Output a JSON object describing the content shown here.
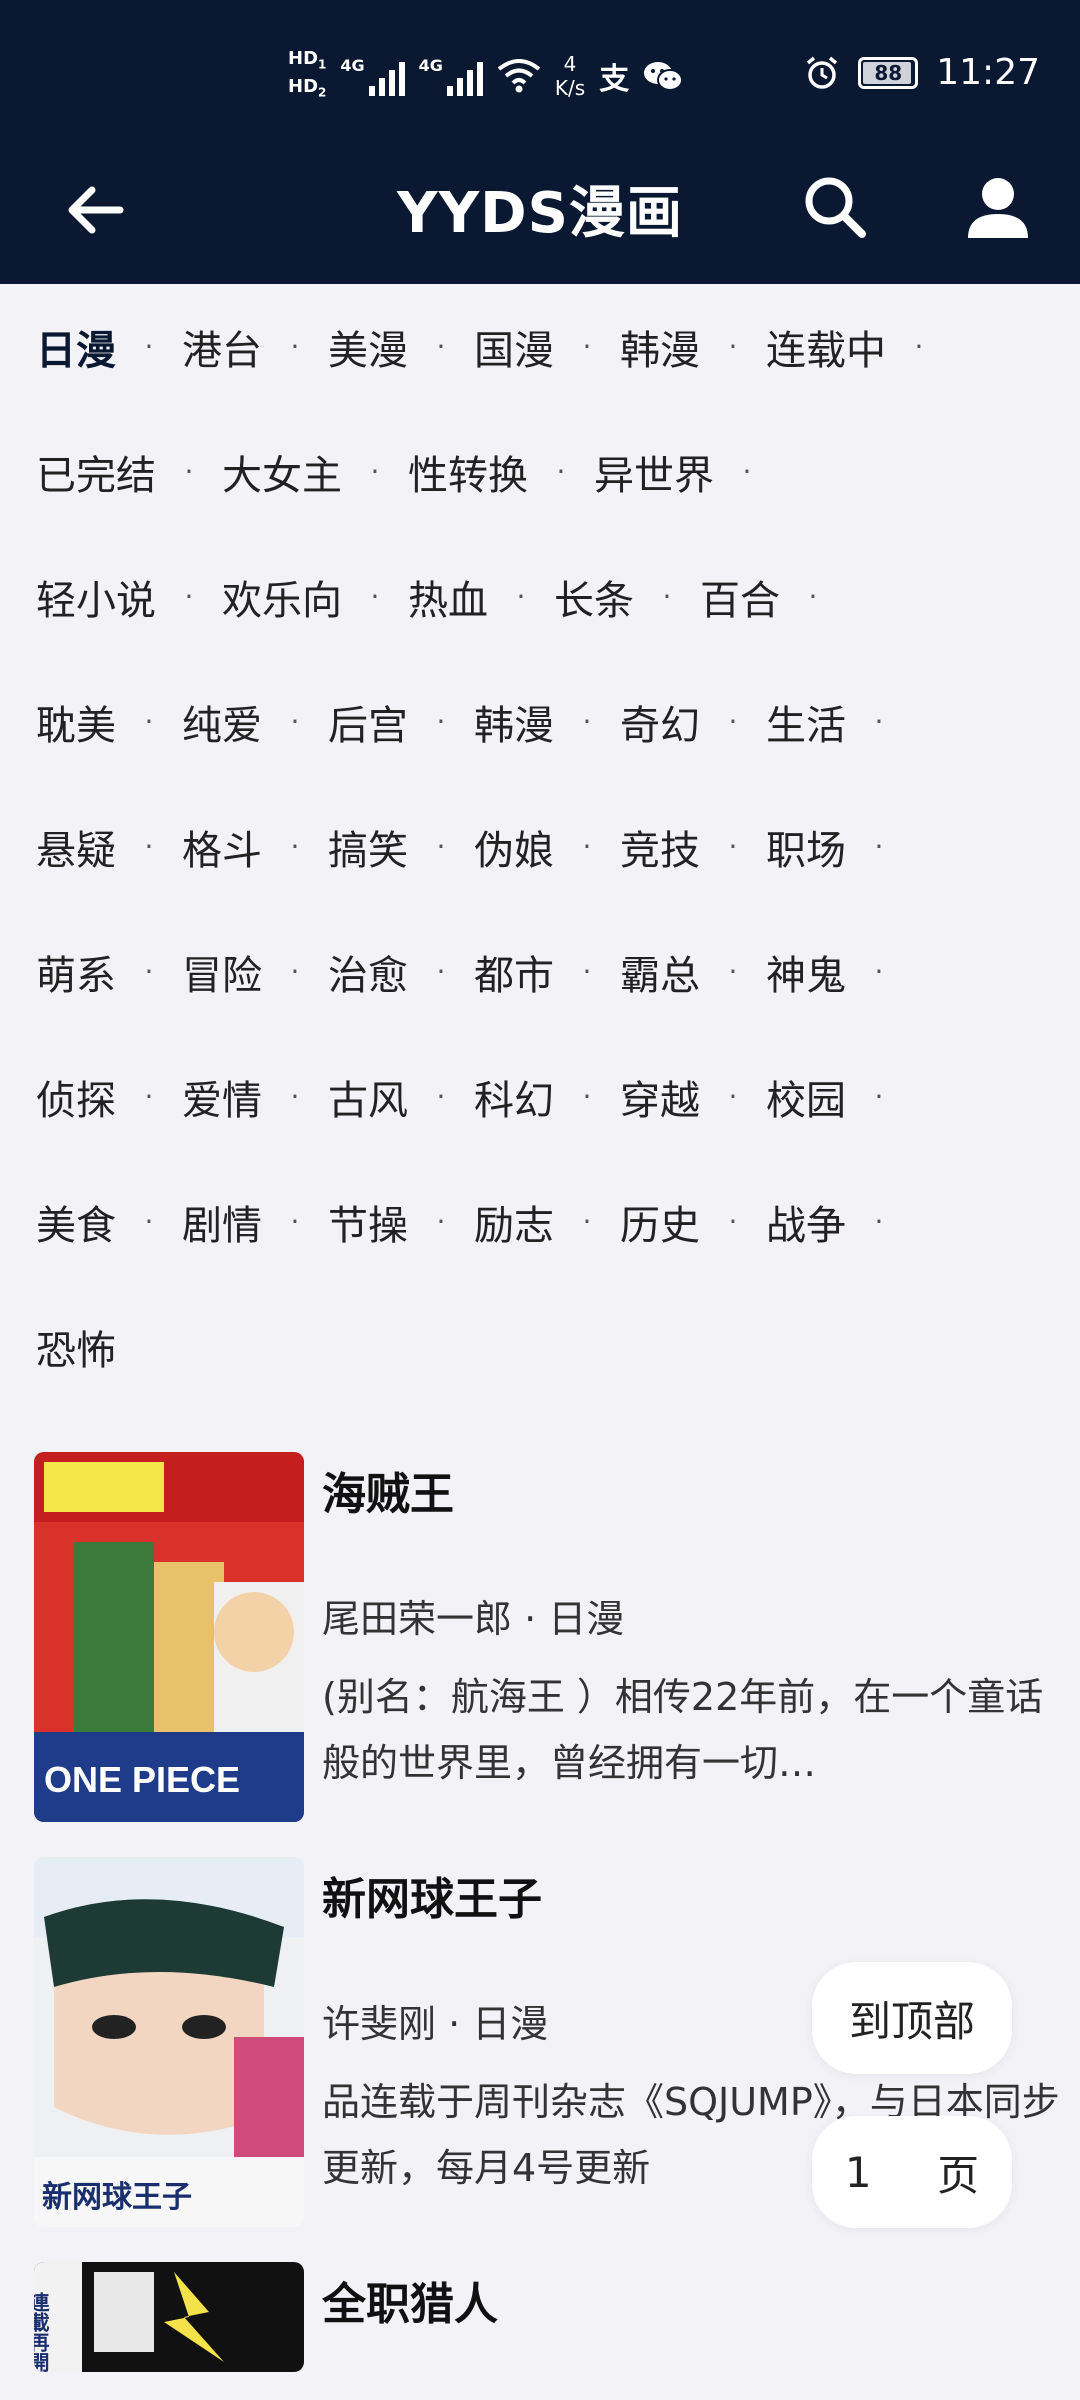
{
  "status_bar": {
    "hd1": "HD",
    "hd1_sub": "1",
    "hd2": "HD",
    "hd2_sub": "2",
    "sig1_label": "4G",
    "sig2_label": "4G",
    "net_speed_value": "4",
    "net_speed_unit": "K/s",
    "alipay_glyph": "支",
    "battery": "88",
    "time": "11:27"
  },
  "app_bar": {
    "title": "YYDS漫画"
  },
  "categories": [
    [
      "日漫",
      "港台",
      "美漫",
      "国漫",
      "韩漫",
      "连载中"
    ],
    [
      "已完结",
      "大女主",
      "性转换",
      "异世界"
    ],
    [
      "轻小说",
      "欢乐向",
      "热血",
      "长条",
      "百合"
    ],
    [
      "耽美",
      "纯爱",
      "后宫",
      "韩漫",
      "奇幻",
      "生活"
    ],
    [
      "悬疑",
      "格斗",
      "搞笑",
      "伪娘",
      "竞技",
      "职场"
    ],
    [
      "萌系",
      "冒险",
      "治愈",
      "都市",
      "霸总",
      "神鬼"
    ],
    [
      "侦探",
      "爱情",
      "古风",
      "科幻",
      "穿越",
      "校园"
    ],
    [
      "美食",
      "剧情",
      "节操",
      "励志",
      "历史",
      "战争"
    ],
    [
      "恐怖"
    ]
  ],
  "separator": "·",
  "comics": [
    {
      "title": "海贼王",
      "author": "尾田荣一郎",
      "region": "日漫",
      "desc": "(别名：航海王 ）相传22年前，在一个童话般的世界里，曾经拥有一切…",
      "cover_text": "ONE PIECE"
    },
    {
      "title": "新网球王子",
      "author": "许斐刚",
      "region": "日漫",
      "desc": "品连载于周刊杂志《SQJUMP》，与日本同步更新，每月4号更新",
      "cover_text": "新网球王子"
    },
    {
      "title": "全职猎人",
      "author": "",
      "region": "",
      "desc": "",
      "cover_text": "連載再開"
    }
  ],
  "float": {
    "to_top": "到顶部",
    "page_num": "1",
    "page_label": "页"
  },
  "colors": {
    "header_bg": "#0a1931",
    "page_bg": "#f2f2f7"
  }
}
